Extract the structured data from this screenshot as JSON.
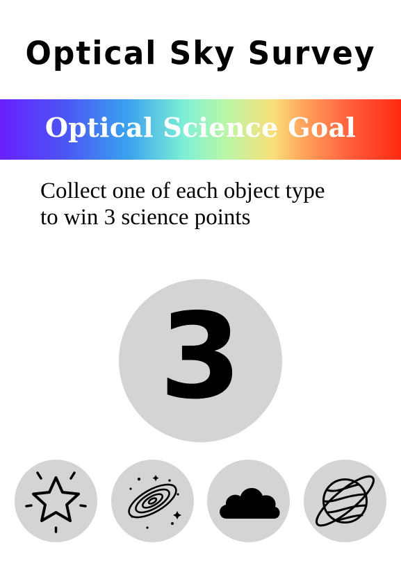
{
  "card": {
    "title": "Optical Sky Survey",
    "goal_banner": "Optical Science Goal",
    "description_line1": "Collect one of each object type",
    "description_line2": "to win 3 science points",
    "points": "3"
  },
  "object_types": [
    {
      "icon": "star-icon"
    },
    {
      "icon": "galaxy-icon"
    },
    {
      "icon": "nebula-cloud-icon"
    },
    {
      "icon": "planet-icon"
    }
  ],
  "colors": {
    "banner_gradient": [
      "#6a1fff",
      "#3aa2ee",
      "#b8f6a8",
      "#ffa25a",
      "#ff2a10"
    ],
    "circle_gray": "#d4d4d4",
    "text": "#000000",
    "banner_text": "#ffffff"
  }
}
